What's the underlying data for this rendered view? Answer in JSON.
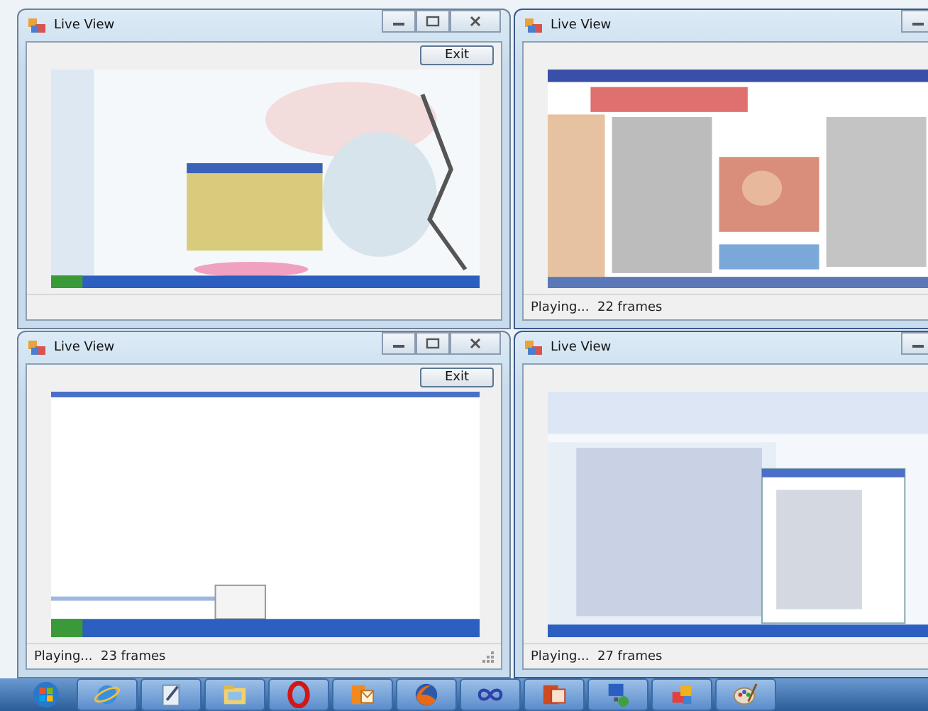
{
  "windows": [
    {
      "title": "Live View",
      "exit_button": "Exit",
      "resize_grip": false
    },
    {
      "title": "Live View",
      "status": "Playing...  22 frames"
    },
    {
      "title": "Live View",
      "exit_button": "Exit",
      "status": "Playing...  23 frames",
      "resize_grip": true
    },
    {
      "title": "Live View",
      "status": "Playing...  27 frames"
    }
  ],
  "taskbar": [
    {
      "kind": "start"
    },
    {
      "kind": "globe"
    },
    {
      "kind": "pen"
    },
    {
      "kind": "folder"
    },
    {
      "kind": "ring"
    },
    {
      "kind": "mail"
    },
    {
      "kind": "fox"
    },
    {
      "kind": "loop"
    },
    {
      "kind": "slides"
    },
    {
      "kind": "network"
    },
    {
      "kind": "squares"
    },
    {
      "kind": "palette"
    }
  ]
}
